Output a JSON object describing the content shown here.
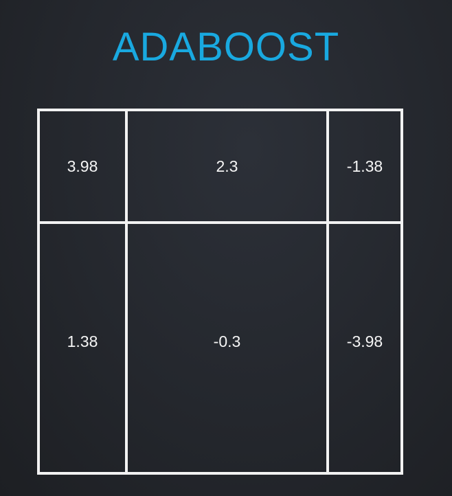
{
  "title": "ADABOOST",
  "grid": {
    "rows": [
      [
        "3.98",
        "2.3",
        "-1.38"
      ],
      [
        "1.38",
        "-0.3",
        "-3.98"
      ]
    ]
  },
  "colors": {
    "title": "#19a9e0",
    "lines": "#f2f2f2",
    "text": "#f5f5f5",
    "background": "#24272d"
  }
}
